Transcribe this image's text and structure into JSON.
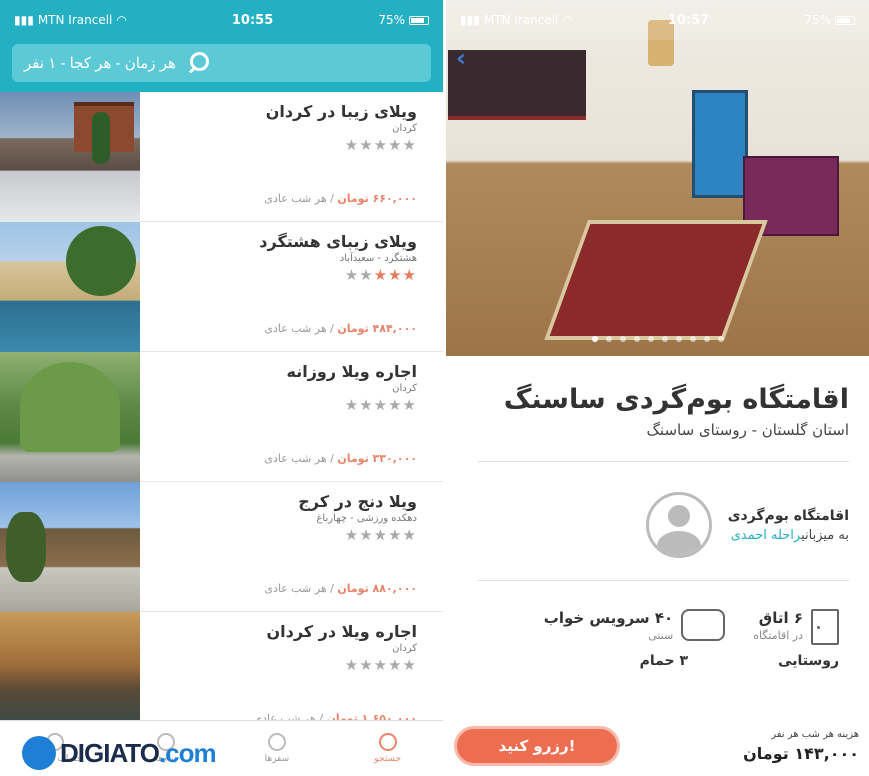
{
  "left": {
    "status": {
      "carrier": "MTN Irancell",
      "time": "10:55",
      "battery": "75%"
    },
    "search": {
      "placeholder": "هر زمان - هر کجا - ۱ نفر"
    },
    "listings": [
      {
        "title": "ویلای زیبا در کردان",
        "location": "کردان",
        "rating": 0,
        "price": "۶۶۰,۰۰۰ تومان",
        "per": "/ هر شب عادی"
      },
      {
        "title": "ویلای زیبای هشتگرد",
        "location": "هشتگرد - سعیدآباد",
        "rating": 3,
        "price": "۴۸۴,۰۰۰ تومان",
        "per": "/ هر شب عادی"
      },
      {
        "title": "اجاره ویلا روزانه",
        "location": "کردان",
        "rating": 0,
        "price": "۳۳۰,۰۰۰ تومان",
        "per": "/ هر شب عادی"
      },
      {
        "title": "ویلا دنج در کرج",
        "location": "دهکده ورزشی - چهارباغ",
        "rating": 0,
        "price": "۸۸۰,۰۰۰ تومان",
        "per": "/ هر شب عادی"
      },
      {
        "title": "اجاره ویلا در کردان",
        "location": "کردان",
        "rating": 0,
        "price": "۱,۶۵۰,۰۰۰ تومان",
        "per": "/ هر شب عادی"
      }
    ],
    "nav": [
      {
        "label": "جستجو",
        "icon": "search-icon",
        "active": true
      },
      {
        "label": "سفرها",
        "icon": "trips-icon",
        "active": false
      },
      {
        "label": "پیام‌ها",
        "icon": "messages-icon",
        "active": false
      },
      {
        "label": "حساب کاربری",
        "icon": "account-icon",
        "active": false
      }
    ],
    "watermark": {
      "main": "DIGIATO",
      "suffix": ".com"
    }
  },
  "right": {
    "status": {
      "carrier": "MTN Irancell",
      "time": "10:57",
      "battery": "75%"
    },
    "title": "اقامتگاه بوم‌گردی ساسنگ",
    "location": "استان گلستان -  روستای ساسنگ",
    "host": {
      "type": "اقامتگاه بوم‌گردی",
      "by_prefix": "به میزبانی",
      "name": "راحله احمدی"
    },
    "stats": [
      {
        "main": "۶ اتاق",
        "sub": "در اقامتگاه",
        "icon": "door-icon"
      },
      {
        "main": "۴۰ سرویس خواب",
        "sub": "سنتی",
        "icon": "pillow-icon"
      }
    ],
    "stats2": [
      "روستایی",
      "۳ حمام"
    ],
    "booking": {
      "button": "رزرو کنید!",
      "label": "هزینه هر شب هر نفر",
      "price": "۱۴۳,۰۰۰ تومان"
    },
    "gallery": {
      "count": 10,
      "active": 0
    }
  }
}
